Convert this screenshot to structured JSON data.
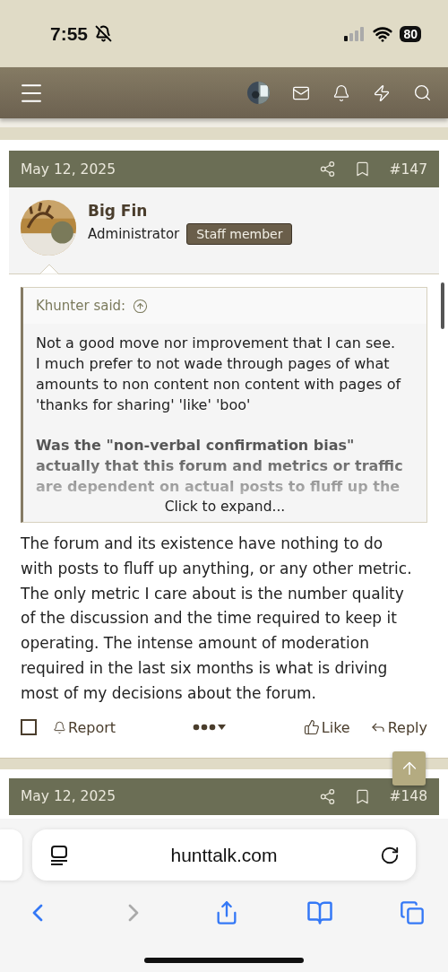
{
  "status_bar": {
    "time": "7:55",
    "battery": "80"
  },
  "posts": [
    {
      "date": "May 12, 2025",
      "number": "#147",
      "author": {
        "name": "Big Fin",
        "role": "Administrator",
        "badge": "Staff member"
      },
      "quote": {
        "author": "Khunter said:",
        "paragraphs": [
          {
            "kind": "plain",
            "text": "Not a good move nor improvement that I can see. I much prefer to not wade through pages of what amounts to non content non content with pages of 'thanks for sharing' 'like' 'boo'"
          },
          {
            "kind": "faded-bold",
            "text": "Was the \"non-verbal confirmation bias\" actually that this forum and metrics or traffic are dependent on actual posts to fluff up the"
          }
        ],
        "expand": "Click to expand..."
      },
      "body": "The forum and its existence have nothing to do with posts to fluff up anything, or any other metric. The only metric I care about is the number quality of the discussion and the time required to keep it operating. The intense amount of moderation required in the last six months is what is driving most of my decisions about the forum.",
      "actions": {
        "selected": false,
        "report": "Report",
        "like": "Like",
        "reply": "Reply"
      }
    },
    {
      "date": "May 12, 2025",
      "number": "#148"
    }
  ],
  "browser": {
    "url": "hunttalk.com"
  }
}
